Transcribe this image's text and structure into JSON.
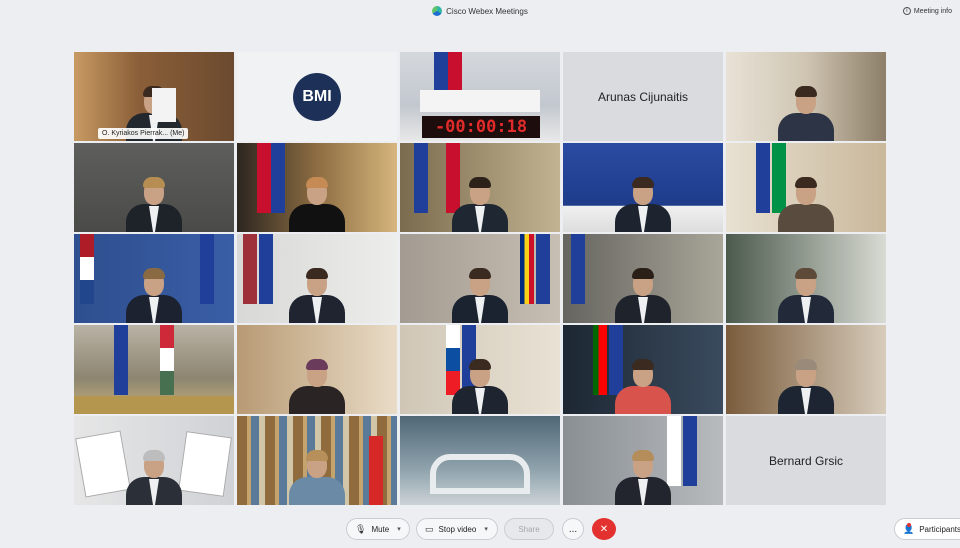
{
  "window": {
    "title": "Cisco Webex Meetings",
    "meeting_info": "Meeting info"
  },
  "participants": [
    {
      "tile": 1,
      "name": "O. Kyriakos Pierrak... (Me)"
    },
    {
      "tile": 2,
      "label": "BMI"
    },
    {
      "tile": 3,
      "timer": "-00:00:18"
    },
    {
      "tile": 4,
      "name": "Arunas Cijunaitis"
    },
    {
      "tile": 25,
      "name": "Bernard Grsic"
    }
  ],
  "toolbar": {
    "mute": "Mute",
    "stop_video": "Stop video",
    "share": "Share",
    "more": "...",
    "participants": "Participants"
  },
  "colors": {
    "accent": "#3db5e6",
    "end_call": "#e2312e",
    "timer_red": "#e12b2b"
  }
}
